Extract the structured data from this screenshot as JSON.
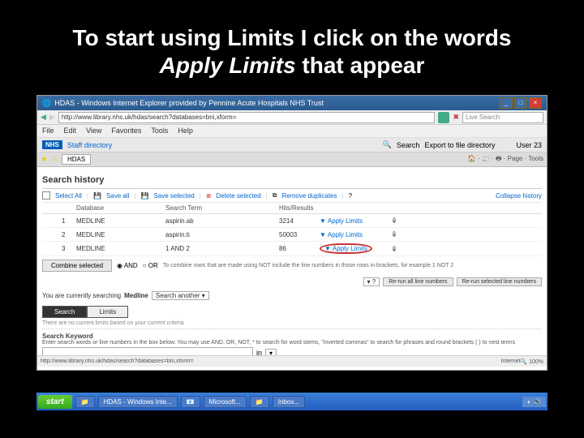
{
  "slide": {
    "title_part1": "To start using Limits I click on the words ",
    "title_em": "Apply Limits",
    "title_part2": " that appear"
  },
  "titlebar": {
    "text": "HDAS - Windows Internet Explorer provided by Pennine Acute Hospitals NHS Trust"
  },
  "address": {
    "url": "http://www.library.nhs.uk/hdas/search?databases=bni,xform=",
    "search_placeholder": "Live Search"
  },
  "menu": {
    "file": "File",
    "edit": "Edit",
    "view": "View",
    "favorites": "Favorites",
    "tools": "Tools",
    "help": "Help"
  },
  "toolbar2": {
    "nhs": "NHS",
    "staff_dir": "Staff directory",
    "search": "Search",
    "export": "Export to file directory",
    "user": "User 23"
  },
  "tabbar": {
    "tab": "HDAS",
    "page": "Page",
    "tools": "Tools"
  },
  "history": {
    "title": "Search history",
    "select_all": "Select All",
    "save_all": "Save all",
    "save_selected": "Save selected",
    "delete_selected": "Delete selected",
    "remove_dup": "Remove duplicates",
    "collapse": "Collapse history",
    "head_db": "Database",
    "head_term": "Search Term",
    "head_hits": "Hits/Results",
    "rows": [
      {
        "num": "1",
        "db": "MEDLINE",
        "term": "aspirin.ab",
        "hits": "3214",
        "apply": "Apply Limits"
      },
      {
        "num": "2",
        "db": "MEDLINE",
        "term": "aspirin.ti",
        "hits": "50003",
        "apply": "Apply Limits"
      },
      {
        "num": "3",
        "db": "MEDLINE",
        "term": "1 AND 2",
        "hits": "86",
        "apply": "Apply Limits"
      }
    ],
    "combine": "Combine selected",
    "and": "AND",
    "or": "OR",
    "hint": "To combine rows that are made using NOT include the line numbers in those rows in brackets, for example 1 NOT 2",
    "rerun_all": "Re-run all line numbers",
    "rerun_sel": "Re-run selected line numbers"
  },
  "searching": {
    "label": "You are currently searching",
    "db": "Medline",
    "other": "Search another"
  },
  "tabs2": {
    "search": "Search",
    "limits": "Limits"
  },
  "tip": "There are no current limits based on your current criteria",
  "keyword": {
    "label": "Search Keyword",
    "desc": "Enter search words or line numbers in the box below. You may use AND, OR, NOT, * to search for word stems, \"inverted commas\" to search for phrases and round brackets ( ) to nest terms",
    "value": "",
    "in": "in"
  },
  "statusbar": {
    "url": "http://www.library.nhs.uk/hdas/search?databases=bni,xform=",
    "internet": "Internet",
    "zoom": "100%"
  },
  "taskbar": {
    "start": "start",
    "items": [
      "",
      "HDAS - Windows Inte...",
      "",
      "Microsoft...",
      "",
      "Inbox..."
    ]
  }
}
